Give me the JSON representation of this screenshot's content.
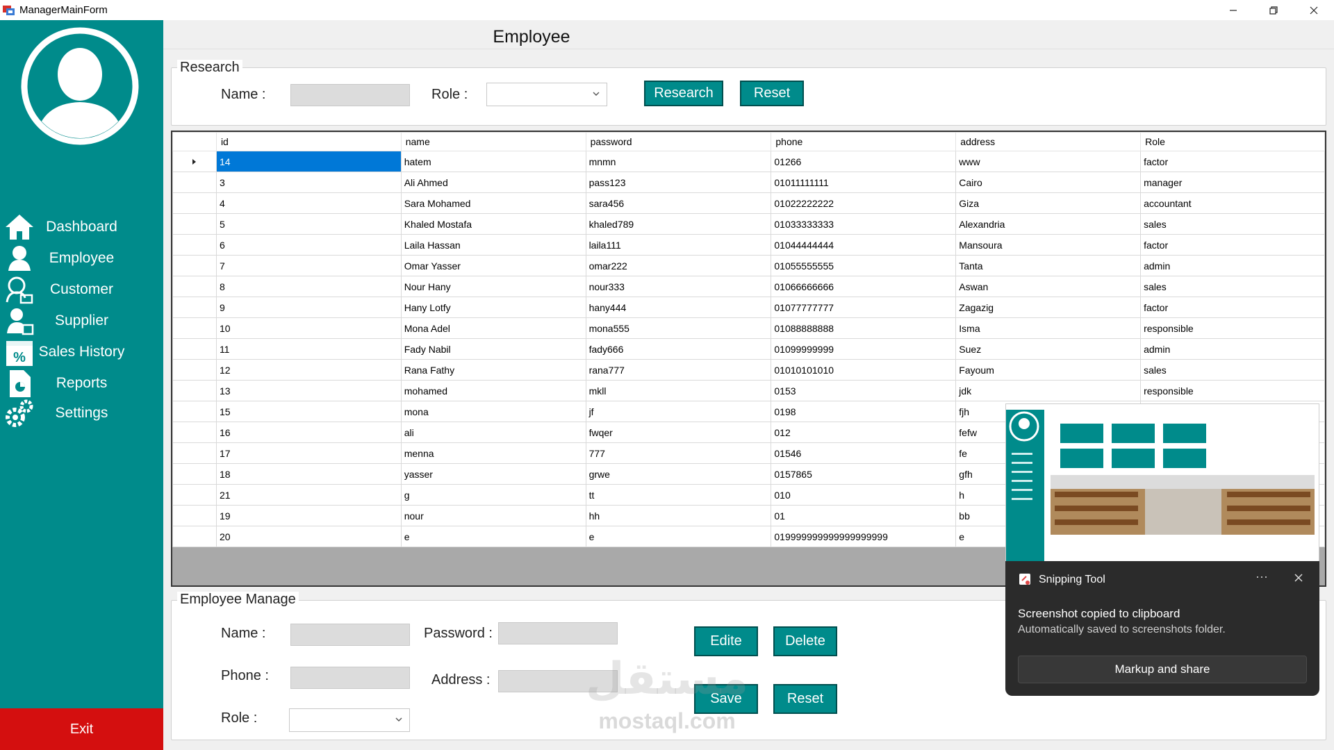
{
  "window": {
    "title": "ManagerMainForm"
  },
  "sidebar": {
    "items": [
      {
        "label": "Dashboard",
        "icon": "home-icon"
      },
      {
        "label": "Employee",
        "icon": "user-icon"
      },
      {
        "label": "Customer",
        "icon": "customer-icon"
      },
      {
        "label": "Supplier",
        "icon": "supplier-icon"
      },
      {
        "label": "Sales History",
        "icon": "sales-percent-icon"
      },
      {
        "label": "Reports",
        "icon": "report-icon"
      },
      {
        "label": "Settings",
        "icon": "gear-icon"
      }
    ],
    "exit_label": "Exit"
  },
  "page_title": "Employee",
  "research": {
    "legend": "Research",
    "name_label": "Name :",
    "name_value": "",
    "role_label": "Role :",
    "role_value": "",
    "search_button": "Research",
    "reset_button": "Reset"
  },
  "grid": {
    "columns": [
      "id",
      "name",
      "password",
      "phone",
      "address",
      "Role"
    ],
    "selected_row": 0,
    "rows": [
      [
        "14",
        "hatem",
        "mnmn",
        "01266",
        "www",
        "factor"
      ],
      [
        "3",
        "Ali Ahmed",
        "pass123",
        "01011111111",
        "Cairo",
        "manager"
      ],
      [
        "4",
        "Sara Mohamed",
        "sara456",
        "01022222222",
        "Giza",
        "accountant"
      ],
      [
        "5",
        "Khaled Mostafa",
        "khaled789",
        "01033333333",
        "Alexandria",
        "sales"
      ],
      [
        "6",
        "Laila Hassan",
        "laila111",
        "01044444444",
        "Mansoura",
        "factor"
      ],
      [
        "7",
        "Omar Yasser",
        "omar222",
        "01055555555",
        "Tanta",
        "admin"
      ],
      [
        "8",
        "Nour Hany",
        "nour333",
        "01066666666",
        "Aswan",
        "sales"
      ],
      [
        "9",
        "Hany Lotfy",
        "hany444",
        "01077777777",
        "Zagazig",
        "factor"
      ],
      [
        "10",
        "Mona Adel",
        "mona555",
        "01088888888",
        "Isma",
        "responsible"
      ],
      [
        "11",
        "Fady Nabil",
        "fady666",
        "01099999999",
        "Suez",
        "admin"
      ],
      [
        "12",
        "Rana Fathy",
        "rana777",
        "01010101010",
        "Fayoum",
        "sales"
      ],
      [
        "13",
        "mohamed",
        "mkll",
        "0153",
        "jdk",
        "responsible"
      ],
      [
        "15",
        "mona",
        "jf",
        "0198",
        "fjh",
        ""
      ],
      [
        "16",
        "ali",
        "fwqer",
        "012",
        "fefw",
        ""
      ],
      [
        "17",
        "menna",
        "777",
        "01546",
        "fe",
        ""
      ],
      [
        "18",
        "yasser",
        "grwe",
        "0157865",
        "gfh",
        ""
      ],
      [
        "21",
        "g",
        "tt",
        "010",
        "h",
        ""
      ],
      [
        "19",
        "nour",
        "hh",
        "01",
        "bb",
        ""
      ],
      [
        "20",
        "e",
        "e",
        "019999999999999999999",
        "e",
        ""
      ]
    ]
  },
  "manage": {
    "legend": "Employee Manage",
    "name_label": "Name :",
    "password_label": "Password :",
    "phone_label": "Phone :",
    "address_label": "Address :",
    "role_label": "Role :",
    "edit_button": "Edite",
    "delete_button": "Delete",
    "save_button": "Save",
    "reset_button": "Reset"
  },
  "toast": {
    "app_name": "Snipping Tool",
    "more": "···",
    "message": "Screenshot copied to clipboard",
    "detail": "Automatically saved to screenshots folder.",
    "action": "Markup and share"
  },
  "watermark": {
    "arabic": "مستقل",
    "latin": "mostaql.com"
  },
  "colors": {
    "sidebar": "#008b8b",
    "exit": "#d40f0f",
    "button": "#008b8b",
    "selection": "#0078d7"
  }
}
